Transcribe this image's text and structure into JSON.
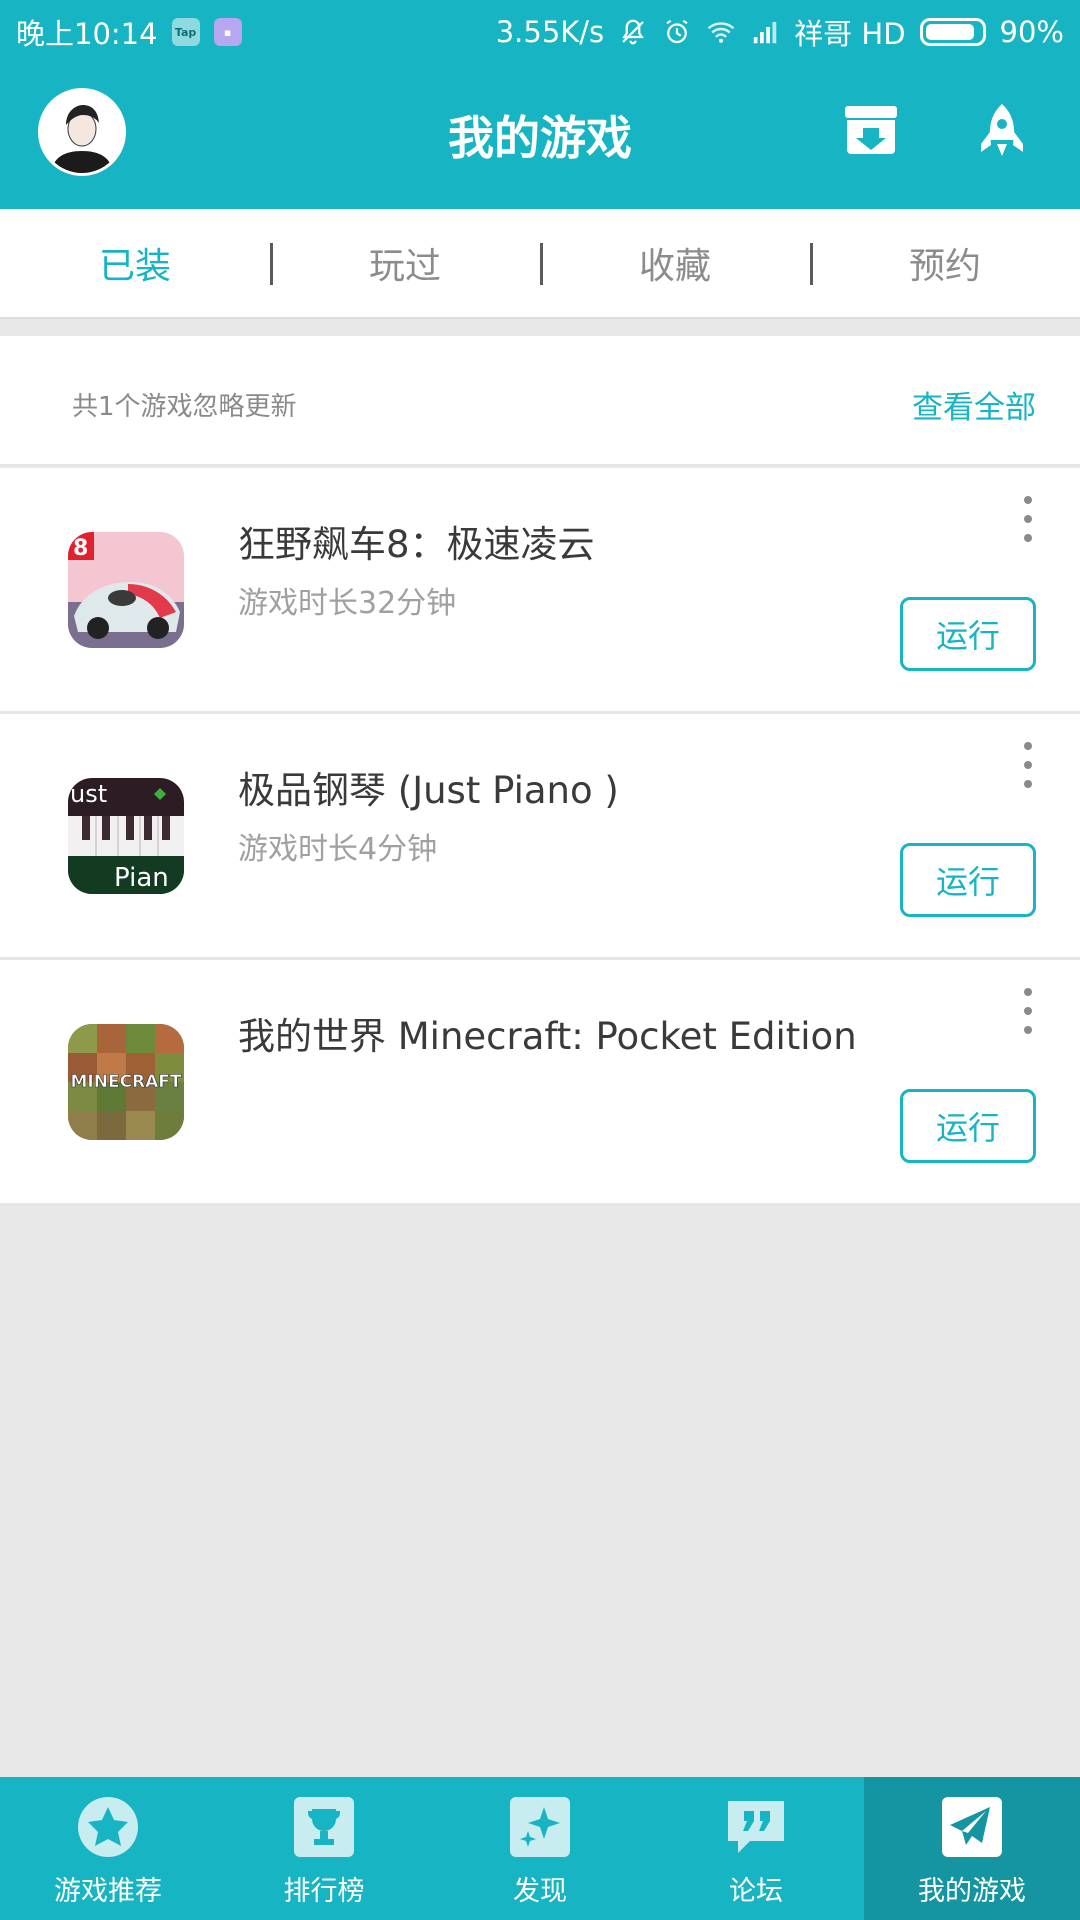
{
  "status_bar": {
    "time": "晚上10:14",
    "app_badge_1": "Tap",
    "network_speed": "3.55K/s",
    "carrier": "祥哥 HD",
    "battery": "90%",
    "battery_level": 0.9,
    "icons": [
      "tap-badge",
      "app-badge",
      "mute-bell",
      "alarm",
      "wifi",
      "signal",
      "battery"
    ]
  },
  "header": {
    "title": "我的游戏",
    "right_icons": [
      "download-box-icon",
      "rocket-icon"
    ],
    "accent": "#17b4c3"
  },
  "tabs": [
    {
      "label": "已装",
      "active": true
    },
    {
      "label": "玩过",
      "active": false
    },
    {
      "label": "收藏",
      "active": false
    },
    {
      "label": "预约",
      "active": false
    }
  ],
  "notice": {
    "text": "共1个游戏忽略更新",
    "link": "查看全部"
  },
  "games": [
    {
      "name": "狂野飙车8：极速凌云",
      "playtime": "游戏时长32分钟",
      "action": "运行",
      "icon": "asphalt-8-icon",
      "icon_text": "8"
    },
    {
      "name": "极品钢琴 (Just Piano )",
      "playtime": "游戏时长4分钟",
      "action": "运行",
      "icon": "just-piano-icon",
      "icon_text_top": "ust",
      "icon_text_bottom": "Pian"
    },
    {
      "name": "我的世界 Minecraft: Pocket Edition",
      "playtime": "",
      "action": "运行",
      "icon": "minecraft-icon",
      "icon_text": "MINECRAFT"
    }
  ],
  "bottom_nav": [
    {
      "label": "游戏推荐",
      "icon": "star-icon",
      "active": false
    },
    {
      "label": "排行榜",
      "icon": "trophy-icon",
      "active": false
    },
    {
      "label": "发现",
      "icon": "sparkle-icon",
      "active": false
    },
    {
      "label": "论坛",
      "icon": "quote-icon",
      "active": false
    },
    {
      "label": "我的游戏",
      "icon": "paper-plane-icon",
      "active": true
    }
  ]
}
